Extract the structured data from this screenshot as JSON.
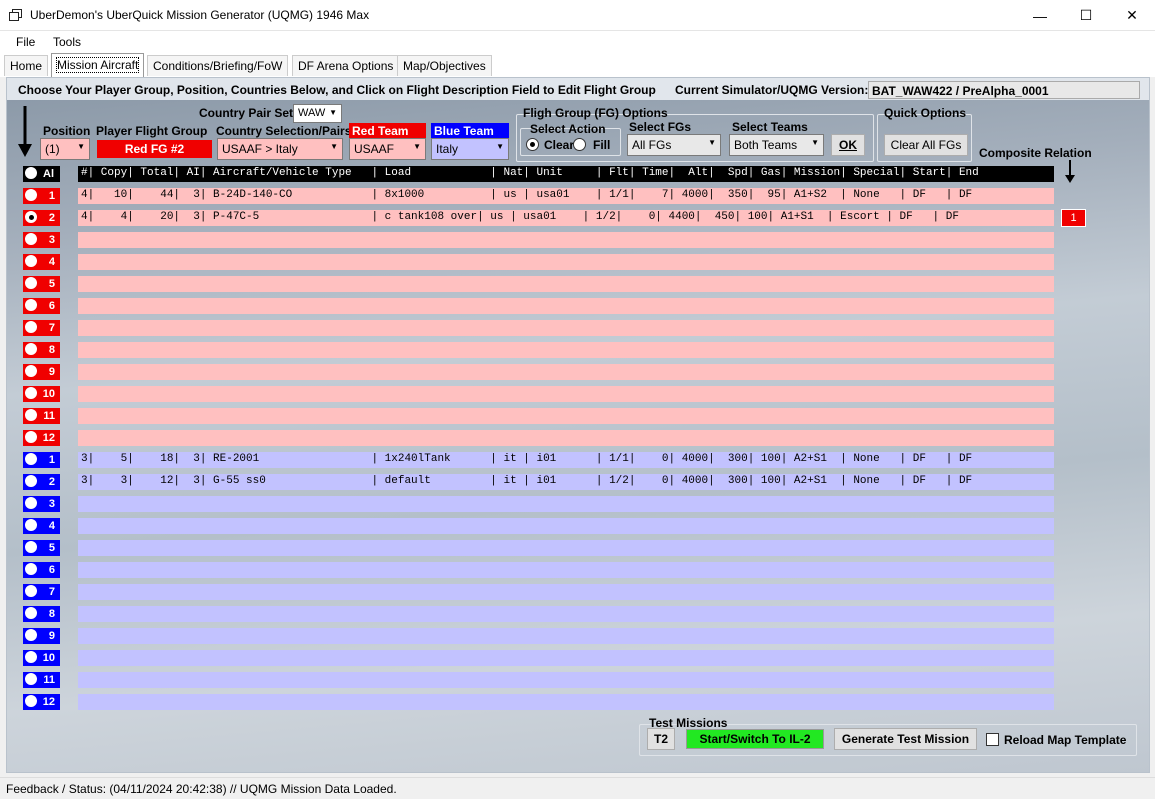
{
  "window": {
    "title": "UberDemon's UberQuick Mission Generator (UQMG) 1946 Max",
    "minimize": "—",
    "maximize": "☐",
    "close": "✕"
  },
  "menu": [
    "File",
    "Tools"
  ],
  "tabs": [
    "Home",
    "Mission Aircraft",
    "Conditions/Briefing/FoW",
    "DF Arena Options",
    "Map/Objectives"
  ],
  "header": {
    "instructions": "Choose Your Player Group, Position, Countries Below, and Click on Flight Description Field to Edit Flight Group",
    "version_label": "Current Simulator/UQMG Version:",
    "version_value": "BAT_WAW422 / PreAlpha_0001"
  },
  "controls": {
    "country_pair_set_label": "Country Pair Set",
    "country_pair_set_value": "WAW",
    "position_label": "Position",
    "position_value": "(1)",
    "player_fg_label": "Player Flight Group",
    "player_fg_value": "Red FG #2",
    "country_selection_label": "Country Selection/Pairs",
    "country_selection_value": "USAAF > Italy",
    "red_team_label": "Red Team",
    "red_team_value": "USAAF",
    "blue_team_label": "Blue Team",
    "blue_team_value": "Italy",
    "fg_options_title": "Fligh Group (FG) Options",
    "select_action_title": "Select Action",
    "clear_label": "Clear",
    "fill_label": "Fill",
    "select_fgs_label": "Select FGs",
    "select_fgs_value": "All FGs",
    "select_teams_label": "Select Teams",
    "select_teams_value": "Both Teams",
    "ok_label": "OK",
    "quick_options_title": "Quick Options",
    "clear_all_label": "Clear All FGs",
    "composite_relation_label": "Composite Relation",
    "composite_value": "1",
    "all_label": "Al"
  },
  "grid": {
    "header": "#| Copy| Total| AI| Aircraft/Vehicle Type   | Load            | Nat| Unit     | Flt| Time|  Alt|  Spd| Gas| Mission| Special| Start| End",
    "red_rows": [
      {
        "num": "1",
        "text": "4|   10|    44|  3| B-24D-140-CO            | 8x1000          | us | usa01    | 1/1|    7| 4000|  350|  95| A1+S2  | None   | DF   | DF",
        "checked": false
      },
      {
        "num": "2",
        "text": "4|    4|    20|  3| P-47C-5                 | c tank108 over| us | usa01    | 1/2|    0| 4400|  450| 100| A1+S1  | Escort | DF   | DF",
        "checked": true
      },
      {
        "num": "3",
        "text": "",
        "checked": false
      },
      {
        "num": "4",
        "text": "",
        "checked": false
      },
      {
        "num": "5",
        "text": "",
        "checked": false
      },
      {
        "num": "6",
        "text": "",
        "checked": false
      },
      {
        "num": "7",
        "text": "",
        "checked": false
      },
      {
        "num": "8",
        "text": "",
        "checked": false
      },
      {
        "num": "9",
        "text": "",
        "checked": false
      },
      {
        "num": "10",
        "text": "",
        "checked": false
      },
      {
        "num": "11",
        "text": "",
        "checked": false
      },
      {
        "num": "12",
        "text": "",
        "checked": false
      }
    ],
    "blue_rows": [
      {
        "num": "1",
        "text": "3|    5|    18|  3| RE-2001                 | 1x240lTank      | it | i01      | 1/1|    0| 4000|  300| 100| A2+S1  | None   | DF   | DF",
        "checked": false
      },
      {
        "num": "2",
        "text": "3|    3|    12|  3| G-55 ss0                | default         | it | i01      | 1/2|    0| 4000|  300| 100| A2+S1  | None   | DF   | DF",
        "checked": false
      },
      {
        "num": "3",
        "text": "",
        "checked": false
      },
      {
        "num": "4",
        "text": "",
        "checked": false
      },
      {
        "num": "5",
        "text": "",
        "checked": false
      },
      {
        "num": "6",
        "text": "",
        "checked": false
      },
      {
        "num": "7",
        "text": "",
        "checked": false
      },
      {
        "num": "8",
        "text": "",
        "checked": false
      },
      {
        "num": "9",
        "text": "",
        "checked": false
      },
      {
        "num": "10",
        "text": "",
        "checked": false
      },
      {
        "num": "11",
        "text": "",
        "checked": false
      },
      {
        "num": "12",
        "text": "",
        "checked": false
      }
    ]
  },
  "test_missions": {
    "title": "Test Missions",
    "t2_label": "T2",
    "start_label": "Start/Switch To IL-2",
    "generate_label": "Generate Test Mission",
    "reload_label": "Reload Map Template"
  },
  "status": {
    "text": "Feedback / Status:  (04/11/2024 20:42:38) // UQMG Mission Data Loaded."
  },
  "colors": {
    "red_team": "#f00000",
    "blue_team": "#0000ff",
    "red_row": "#ffc0c0",
    "blue_row": "#c2c2ff",
    "start_button": "#22e822"
  }
}
